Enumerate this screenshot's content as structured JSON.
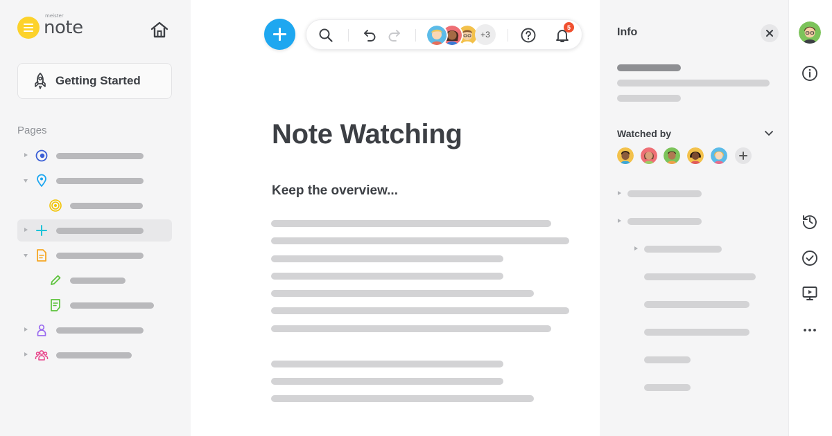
{
  "app": {
    "logo_small": "meister",
    "logo_name": "note",
    "brand_color": "#fcd22b",
    "accent_color": "#1ea7f0"
  },
  "sidebar": {
    "getting_started_label": "Getting Started",
    "pages_label": "Pages",
    "tree": [
      {
        "icon": "eye-icon",
        "expanded": false,
        "level": 0
      },
      {
        "icon": "location-pin-icon",
        "expanded": true,
        "level": 0
      },
      {
        "icon": "target-icon",
        "level": 1
      },
      {
        "icon": "plus-icon",
        "expanded": false,
        "level": 0,
        "selected": true
      },
      {
        "icon": "document-icon",
        "expanded": true,
        "level": 0
      },
      {
        "icon": "pencil-icon",
        "level": 1
      },
      {
        "icon": "note-icon",
        "level": 1
      },
      {
        "icon": "person-icon",
        "expanded": false,
        "level": 0
      },
      {
        "icon": "group-icon",
        "expanded": false,
        "level": 0
      }
    ]
  },
  "toolbar": {
    "more_collaborators": "+3",
    "notification_count": "5"
  },
  "document": {
    "title": "Note Watching",
    "subtitle": "Keep the overview..."
  },
  "info_panel": {
    "title": "Info",
    "watched_by_label": "Watched by"
  }
}
